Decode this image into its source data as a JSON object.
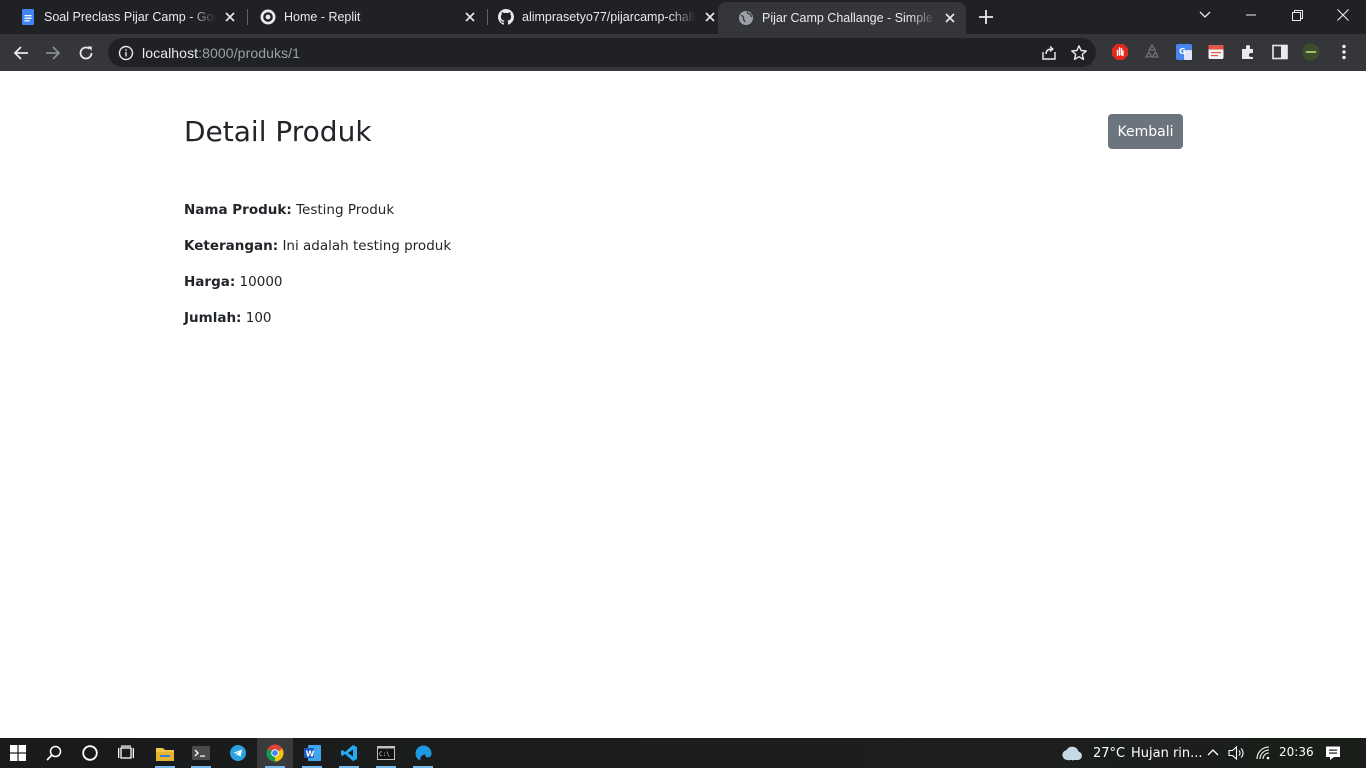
{
  "browser": {
    "tabs": [
      {
        "title": "Soal Preclass Pijar Camp - Google Docs",
        "icon": "google-docs-icon"
      },
      {
        "title": "Home - Replit",
        "icon": "replit-icon"
      },
      {
        "title": "alimprasetyo77/pijarcamp-challange",
        "icon": "github-icon"
      },
      {
        "title": "Pijar Camp Challange - Simple Crud",
        "icon": "globe-icon",
        "active": true
      }
    ],
    "url_host": "localhost",
    "url_path": ":8000/produks/1",
    "accent_color": "#35363a"
  },
  "page": {
    "heading": "Detail Produk",
    "back_button": "Kembali",
    "fields": [
      {
        "label": "Nama Produk:",
        "value": "Testing Produk"
      },
      {
        "label": "Keterangan:",
        "value": "Ini adalah testing produk"
      },
      {
        "label": "Harga:",
        "value": "10000"
      },
      {
        "label": "Jumlah:",
        "value": "100"
      }
    ],
    "button_color": "#6c757d"
  },
  "taskbar": {
    "weather": "27°C",
    "weather_desc": "Hujan rin...",
    "time": "20:36"
  }
}
